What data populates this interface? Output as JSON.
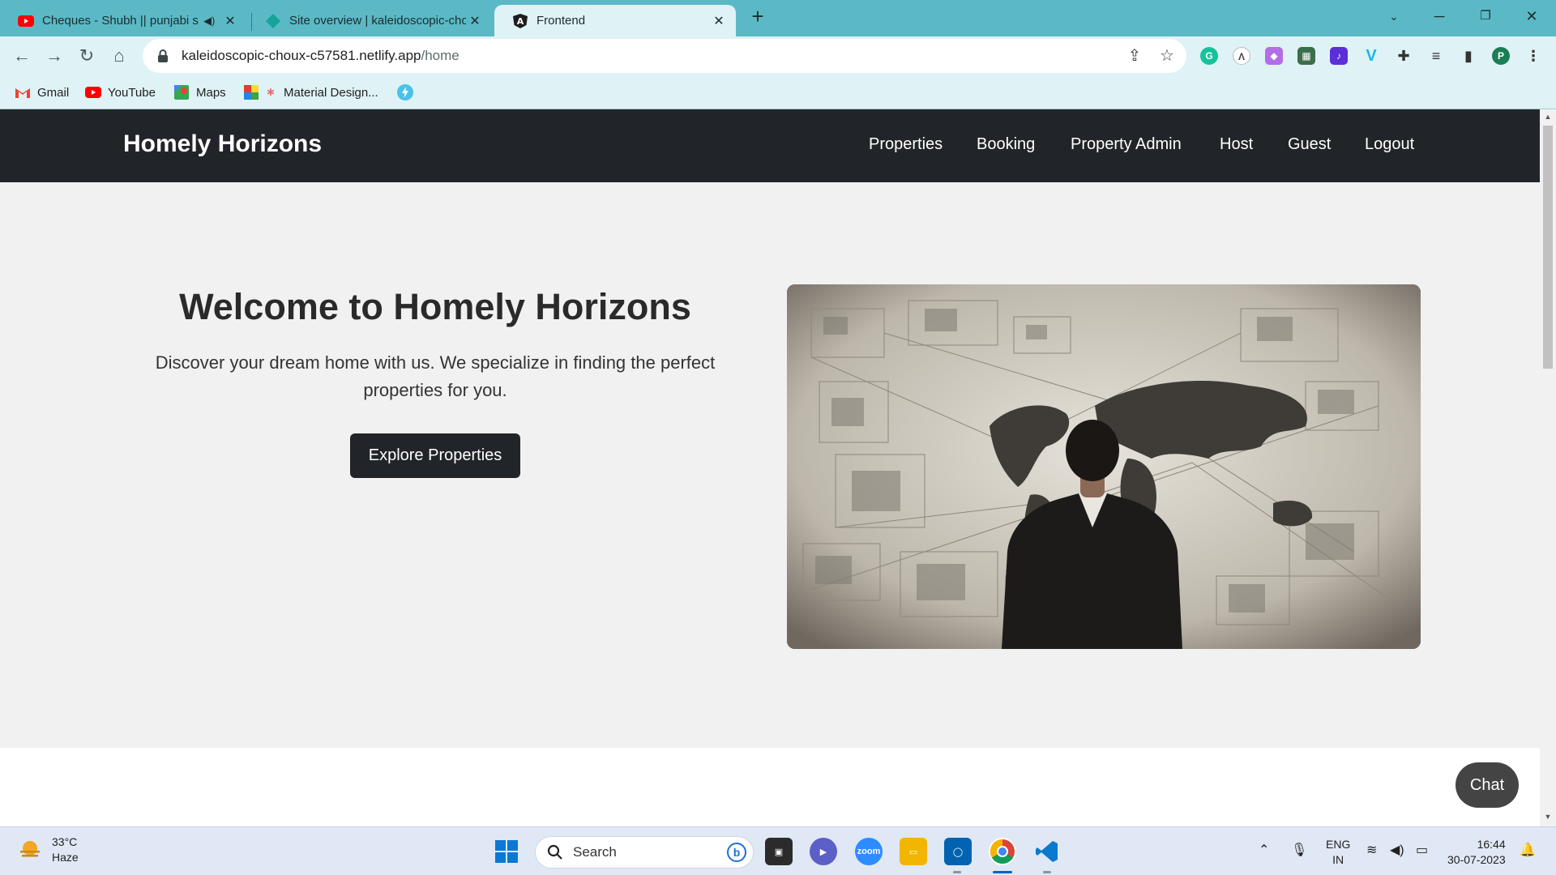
{
  "browser": {
    "tabs": [
      {
        "title": "Cheques - Shubh || punjabi s",
        "icon": "youtube-icon",
        "muted_icon": "speaker-icon"
      },
      {
        "title": "Site overview | kaleidoscopic-cho",
        "icon": "netlify-icon"
      },
      {
        "title": "Frontend",
        "icon": "angular-icon"
      }
    ],
    "url_host": "kaleidoscopic-choux-c57581.netlify.app",
    "url_path": "/home",
    "profile_initial": "P",
    "bookmarks": [
      {
        "label": "Gmail",
        "icon": "gmail-icon"
      },
      {
        "label": "YouTube",
        "icon": "youtube-icon"
      },
      {
        "label": "Maps",
        "icon": "maps-icon"
      },
      {
        "label": "Material Design...",
        "icon": "material-icon"
      }
    ]
  },
  "site": {
    "brand": "Homely Horizons",
    "nav": [
      "Properties",
      "Booking",
      "Property Admin",
      "Host",
      "Guest",
      "Logout"
    ],
    "hero": {
      "title": "Welcome to Homely Horizons",
      "subtitle": "Discover your dream home with us. We specialize in finding the perfect properties for you.",
      "cta": "Explore Properties",
      "image_alt": "man-looking-at-world-map"
    },
    "chat_label": "Chat"
  },
  "taskbar": {
    "temperature": "33°C",
    "condition": "Haze",
    "search_placeholder": "Search",
    "lang_line1": "ENG",
    "lang_line2": "IN",
    "time": "16:44",
    "date": "30-07-2023"
  },
  "colors": {
    "tabstrip": "#5bb9c6",
    "toolbar": "#dff2f5",
    "navbar": "#212529",
    "page_bg": "#f1f1f1"
  }
}
